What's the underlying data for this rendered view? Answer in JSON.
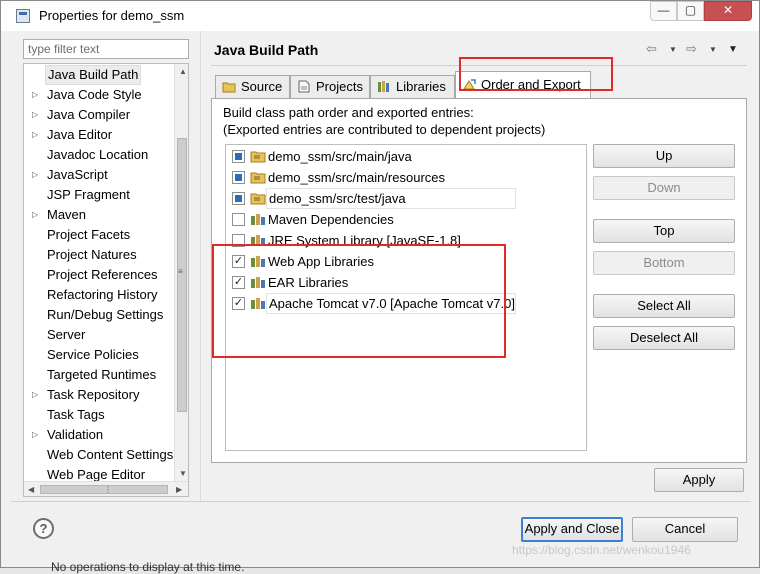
{
  "window": {
    "title": "Properties for demo_ssm",
    "controls": [
      "—",
      "▢",
      "✕"
    ]
  },
  "filter": {
    "placeholder": "type filter text"
  },
  "tree": {
    "items": [
      {
        "label": "Java Build Path",
        "expandable": false,
        "selected": true
      },
      {
        "label": "Java Code Style",
        "expandable": true
      },
      {
        "label": "Java Compiler",
        "expandable": true
      },
      {
        "label": "Java Editor",
        "expandable": true
      },
      {
        "label": "Javadoc Location",
        "expandable": false
      },
      {
        "label": "JavaScript",
        "expandable": true
      },
      {
        "label": "JSP Fragment",
        "expandable": false
      },
      {
        "label": "Maven",
        "expandable": true
      },
      {
        "label": "Project Facets",
        "expandable": false
      },
      {
        "label": "Project Natures",
        "expandable": false
      },
      {
        "label": "Project References",
        "expandable": false
      },
      {
        "label": "Refactoring History",
        "expandable": false
      },
      {
        "label": "Run/Debug Settings",
        "expandable": false
      },
      {
        "label": "Server",
        "expandable": false
      },
      {
        "label": "Service Policies",
        "expandable": false
      },
      {
        "label": "Targeted Runtimes",
        "expandable": false
      },
      {
        "label": "Task Repository",
        "expandable": true
      },
      {
        "label": "Task Tags",
        "expandable": false
      },
      {
        "label": "Validation",
        "expandable": true
      },
      {
        "label": "Web Content Settings",
        "expandable": false
      },
      {
        "label": "Web Page Editor",
        "expandable": false
      }
    ]
  },
  "page": {
    "title": "Java Build Path"
  },
  "tabs": [
    {
      "label": "Source",
      "active": false
    },
    {
      "label": "Projects",
      "active": false
    },
    {
      "label": "Libraries",
      "active": false
    },
    {
      "label": "Order and Export",
      "active": true
    }
  ],
  "panel": {
    "description_line1": "Build class path order and exported entries:",
    "description_line2": "(Exported entries are contributed to dependent projects)",
    "entries": [
      {
        "label": "demo_ssm/src/main/java",
        "checked": true,
        "kind": "source-folder"
      },
      {
        "label": "demo_ssm/src/main/resources",
        "checked": true,
        "kind": "source-folder"
      },
      {
        "label": "demo_ssm/src/test/java",
        "checked": true,
        "kind": "source-folder",
        "highlighted": true
      },
      {
        "label": "Maven Dependencies",
        "checked": false,
        "kind": "library"
      },
      {
        "label": "JRE System Library [JavaSE-1.8]",
        "checked": false,
        "kind": "library"
      },
      {
        "label": "Web App Libraries",
        "checked": true,
        "kind": "library"
      },
      {
        "label": "EAR Libraries",
        "checked": true,
        "kind": "library"
      },
      {
        "label": "Apache Tomcat v7.0 [Apache Tomcat v7.0]",
        "checked": true,
        "kind": "library",
        "highlighted": true
      }
    ],
    "buttons": {
      "up": "Up",
      "down": "Down",
      "top": "Top",
      "bottom": "Bottom",
      "select_all": "Select All",
      "deselect_all": "Deselect All"
    }
  },
  "footer": {
    "apply": "Apply",
    "apply_and_close": "Apply and Close",
    "cancel": "Cancel",
    "help": "?"
  },
  "watermark": "https://blog.csdn.net/wenkou1946",
  "background_text": "No operations to display at this time.",
  "colors": {
    "annotation": "#e02a2a",
    "accent": "#3c7fd4",
    "checkbox_fill": "#2a6cb8"
  }
}
